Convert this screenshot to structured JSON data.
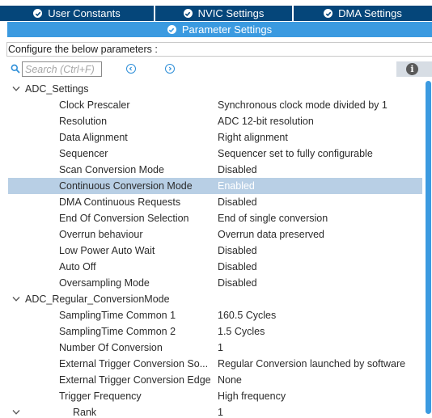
{
  "tabs": {
    "user_constants": "User Constants",
    "nvic_settings": "NVIC Settings",
    "dma_settings": "DMA Settings",
    "parameter_settings": "Parameter Settings"
  },
  "configure_label": "Configure the below parameters :",
  "search": {
    "placeholder": "Search (Ctrl+F)",
    "value": ""
  },
  "tree": {
    "adc_settings": {
      "label": "ADC_Settings",
      "items": [
        {
          "name": "Clock Prescaler",
          "value": "Synchronous clock mode divided by 1"
        },
        {
          "name": "Resolution",
          "value": "ADC 12-bit resolution"
        },
        {
          "name": "Data Alignment",
          "value": "Right alignment"
        },
        {
          "name": "Sequencer",
          "value": "Sequencer set to fully configurable"
        },
        {
          "name": "Scan Conversion Mode",
          "value": "Disabled"
        },
        {
          "name": "Continuous Conversion Mode",
          "value": "Enabled"
        },
        {
          "name": "DMA Continuous Requests",
          "value": "Disabled"
        },
        {
          "name": "End Of Conversion Selection",
          "value": "End of single conversion"
        },
        {
          "name": "Overrun behaviour",
          "value": "Overrun data preserved"
        },
        {
          "name": "Low Power Auto Wait",
          "value": "Disabled"
        },
        {
          "name": "Auto Off",
          "value": "Disabled"
        },
        {
          "name": "Oversampling Mode",
          "value": "Disabled"
        }
      ]
    },
    "adc_regular": {
      "label": "ADC_Regular_ConversionMode",
      "items": [
        {
          "name": "SamplingTime Common 1",
          "value": "160.5 Cycles"
        },
        {
          "name": "SamplingTime Common 2",
          "value": "1.5 Cycles"
        },
        {
          "name": "Number Of Conversion",
          "value": "1"
        },
        {
          "name": "External Trigger Conversion So...",
          "value": "Regular Conversion launched by software"
        },
        {
          "name": "External Trigger Conversion Edge",
          "value": "None"
        },
        {
          "name": "Trigger Frequency",
          "value": "High frequency"
        }
      ],
      "rank": {
        "name": "Rank",
        "value": "1"
      }
    }
  },
  "colors": {
    "tab_dark": "#05467a",
    "tab_active": "#3b9ae0",
    "selection": "#b8cfe5",
    "scroll_thumb": "#3b9ae0"
  }
}
